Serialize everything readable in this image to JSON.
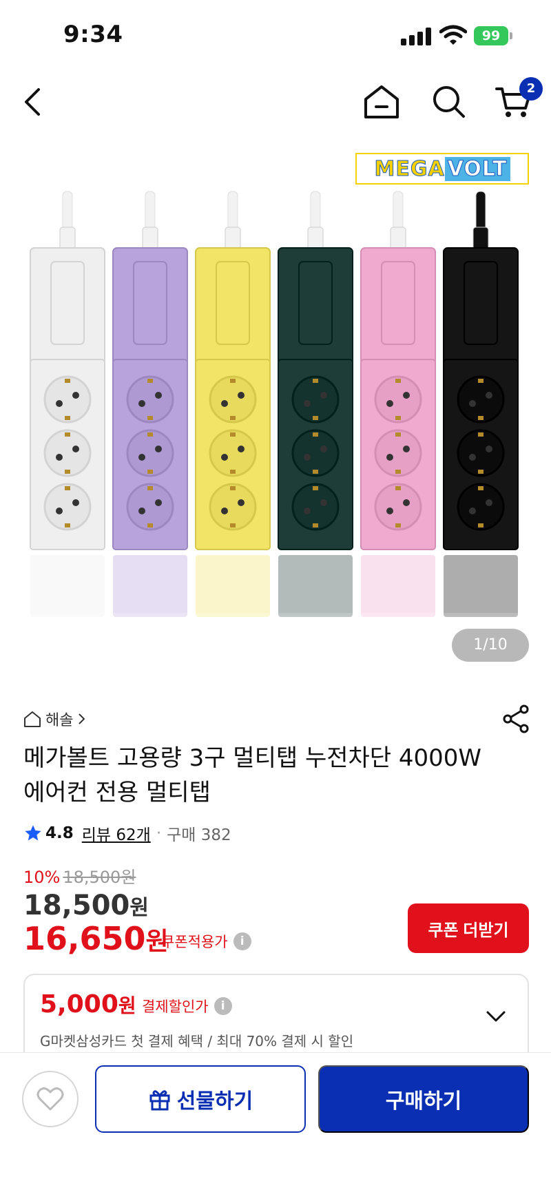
{
  "status_bar": {
    "time": "9:34",
    "battery": "99"
  },
  "nav": {
    "cart_count": "2",
    "icons": [
      "back-icon",
      "home-icon",
      "search-icon",
      "cart-icon"
    ]
  },
  "gallery": {
    "brand_logo_text": "MEGA VOLT",
    "counter": "1/10",
    "strip_colors": [
      "#efefef",
      "#b8a3dc",
      "#f2e466",
      "#1f3d38",
      "#f0a9cf",
      "#151515"
    ]
  },
  "product": {
    "seller": "해솔",
    "title": "메가볼트 고용량 3구 멀티탭 누전차단 4000W 에어컨 전용 멀티탭",
    "rating": "4.8",
    "reviews": "리뷰 62개",
    "purchases": "구매 382"
  },
  "price": {
    "discount_pct": "10%",
    "original": "18,500원",
    "sale_amount": "18,500",
    "sale_unit": "원",
    "coupon_amount": "16,650",
    "coupon_unit": "원",
    "coupon_label": "쿠폰적용가",
    "coupon_button": "쿠폰 더받기"
  },
  "payment": {
    "amount": "5,000",
    "unit": "원",
    "label": "결제할인가",
    "description": "G마켓삼성카드 첫 결제 혜택 / 최대 70% 결제 시 할인"
  },
  "actions": {
    "gift": "선물하기",
    "buy": "구매하기"
  },
  "colors": {
    "accent_red": "#e0111a",
    "brand_blue": "#0b2fb3"
  }
}
